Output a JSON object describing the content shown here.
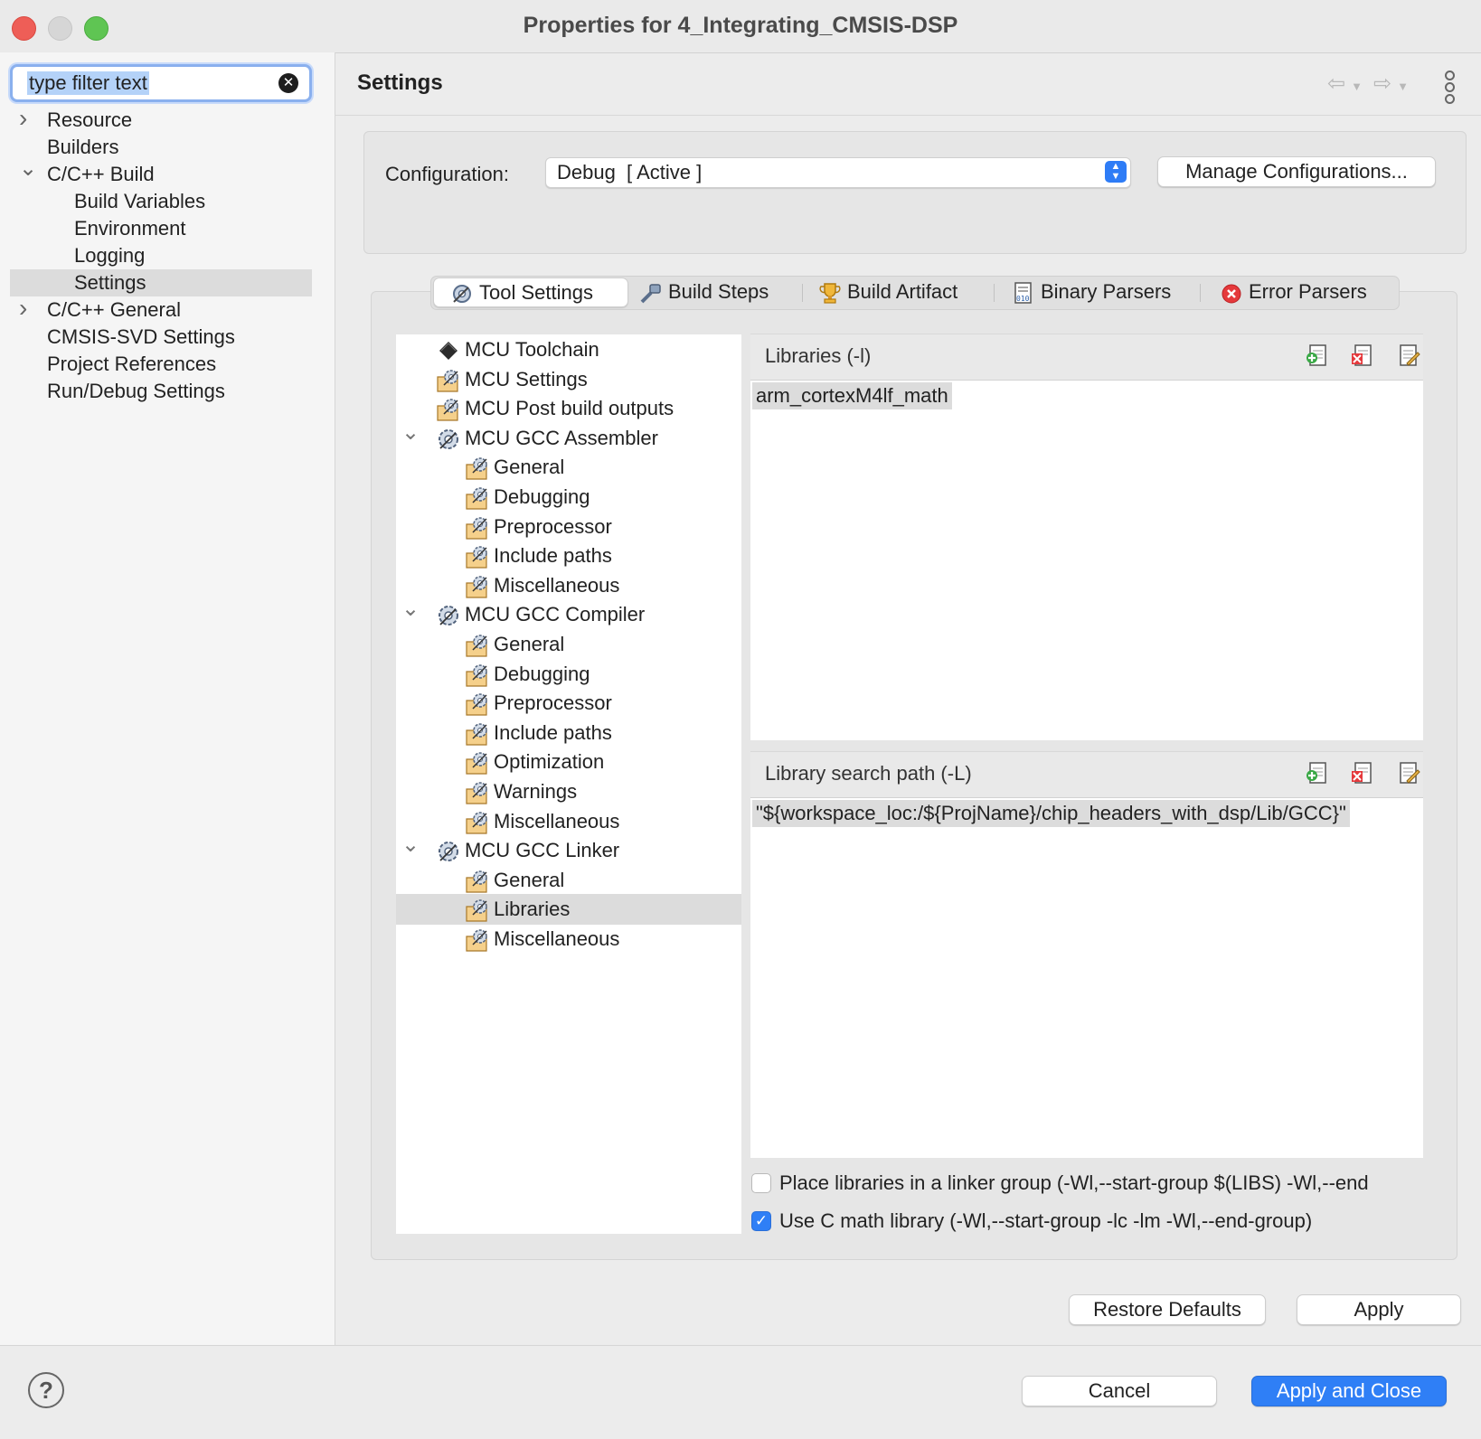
{
  "window": {
    "title": "Properties for 4_Integrating_CMSIS-DSP"
  },
  "filter": {
    "value": "type filter text"
  },
  "left_tree": [
    {
      "label": "Resource",
      "twisty": ">",
      "indent": 0,
      "selected": false
    },
    {
      "label": "Builders",
      "twisty": "",
      "indent": 0,
      "selected": false
    },
    {
      "label": "C/C++ Build",
      "twisty": "v",
      "indent": 0,
      "selected": false
    },
    {
      "label": "Build Variables",
      "twisty": "",
      "indent": 1,
      "selected": false
    },
    {
      "label": "Environment",
      "twisty": "",
      "indent": 1,
      "selected": false
    },
    {
      "label": "Logging",
      "twisty": "",
      "indent": 1,
      "selected": false
    },
    {
      "label": "Settings",
      "twisty": "",
      "indent": 1,
      "selected": true
    },
    {
      "label": "C/C++ General",
      "twisty": ">",
      "indent": 0,
      "selected": false
    },
    {
      "label": "CMSIS-SVD Settings",
      "twisty": "",
      "indent": 0,
      "selected": false
    },
    {
      "label": "Project References",
      "twisty": "",
      "indent": 0,
      "selected": false
    },
    {
      "label": "Run/Debug Settings",
      "twisty": "",
      "indent": 0,
      "selected": false
    }
  ],
  "page": {
    "title": "Settings"
  },
  "config": {
    "label": "Configuration:",
    "value": "Debug  [ Active ]",
    "manage_label": "Manage Configurations..."
  },
  "tabs": [
    {
      "label": "Tool Settings",
      "icon": "gear-tools-icon",
      "active": true
    },
    {
      "label": "Build Steps",
      "icon": "build-steps-icon",
      "active": false
    },
    {
      "label": "Build Artifact",
      "icon": "trophy-icon",
      "active": false
    },
    {
      "label": "Binary Parsers",
      "icon": "binary-file-icon",
      "active": false
    },
    {
      "label": "Error Parsers",
      "icon": "error-icon",
      "active": false
    }
  ],
  "tool_tree": [
    {
      "label": "MCU Toolchain",
      "level": 0,
      "twisty": "",
      "icon": "chip-icon",
      "selected": false
    },
    {
      "label": "MCU Settings",
      "level": 0,
      "twisty": "",
      "icon": "folder-gear-icon",
      "selected": false
    },
    {
      "label": "MCU Post build outputs",
      "level": 0,
      "twisty": "",
      "icon": "folder-gear-icon",
      "selected": false
    },
    {
      "label": "MCU GCC Assembler",
      "level": 0,
      "twisty": "v",
      "icon": "gear-icon",
      "selected": false
    },
    {
      "label": "General",
      "level": 1,
      "twisty": "",
      "icon": "folder-gear-icon",
      "selected": false
    },
    {
      "label": "Debugging",
      "level": 1,
      "twisty": "",
      "icon": "folder-gear-icon",
      "selected": false
    },
    {
      "label": "Preprocessor",
      "level": 1,
      "twisty": "",
      "icon": "folder-gear-icon",
      "selected": false
    },
    {
      "label": "Include paths",
      "level": 1,
      "twisty": "",
      "icon": "folder-gear-icon",
      "selected": false
    },
    {
      "label": "Miscellaneous",
      "level": 1,
      "twisty": "",
      "icon": "folder-gear-icon",
      "selected": false
    },
    {
      "label": "MCU GCC Compiler",
      "level": 0,
      "twisty": "v",
      "icon": "gear-icon",
      "selected": false
    },
    {
      "label": "General",
      "level": 1,
      "twisty": "",
      "icon": "folder-gear-icon",
      "selected": false
    },
    {
      "label": "Debugging",
      "level": 1,
      "twisty": "",
      "icon": "folder-gear-icon",
      "selected": false
    },
    {
      "label": "Preprocessor",
      "level": 1,
      "twisty": "",
      "icon": "folder-gear-icon",
      "selected": false
    },
    {
      "label": "Include paths",
      "level": 1,
      "twisty": "",
      "icon": "folder-gear-icon",
      "selected": false
    },
    {
      "label": "Optimization",
      "level": 1,
      "twisty": "",
      "icon": "folder-gear-icon",
      "selected": false
    },
    {
      "label": "Warnings",
      "level": 1,
      "twisty": "",
      "icon": "folder-gear-icon",
      "selected": false
    },
    {
      "label": "Miscellaneous",
      "level": 1,
      "twisty": "",
      "icon": "folder-gear-icon",
      "selected": false
    },
    {
      "label": "MCU GCC Linker",
      "level": 0,
      "twisty": "v",
      "icon": "gear-icon",
      "selected": false
    },
    {
      "label": "General",
      "level": 1,
      "twisty": "",
      "icon": "folder-gear-icon",
      "selected": false
    },
    {
      "label": "Libraries",
      "level": 1,
      "twisty": "",
      "icon": "folder-gear-icon",
      "selected": true
    },
    {
      "label": "Miscellaneous",
      "level": 1,
      "twisty": "",
      "icon": "folder-gear-icon",
      "selected": false
    }
  ],
  "libraries": {
    "title": "Libraries (-l)",
    "items": [
      "arm_cortexM4lf_math"
    ]
  },
  "library_paths": {
    "title": "Library search path (-L)",
    "items": [
      "\"${workspace_loc:/${ProjName}/chip_headers_with_dsp/Lib/GCC}\""
    ]
  },
  "options": {
    "linker_group": {
      "label": "Place libraries in a linker group (-Wl,--start-group $(LIBS) -Wl,--end",
      "checked": false
    },
    "c_math": {
      "label": "Use C math library (-Wl,--start-group -lc -lm -Wl,--end-group)",
      "checked": true
    }
  },
  "buttons": {
    "restore_defaults": "Restore Defaults",
    "apply": "Apply",
    "cancel": "Cancel",
    "apply_close": "Apply and Close",
    "help": "?"
  },
  "colors": {
    "accent": "#2f7ff6",
    "selection": "#dcdcdc"
  }
}
